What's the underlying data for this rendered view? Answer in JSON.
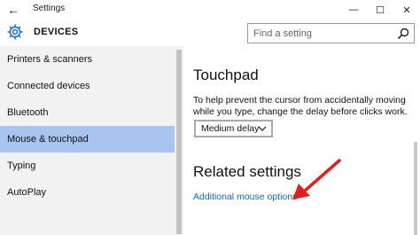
{
  "window": {
    "title": "Settings",
    "back_glyph": "←",
    "minimize_glyph": "—",
    "maximize_glyph": "☐",
    "close_glyph": "✕"
  },
  "header": {
    "title": "DEVICES",
    "icon": "gear-icon",
    "accent": "#1e73c8"
  },
  "search": {
    "placeholder": "Find a setting",
    "icon": "search-icon"
  },
  "sidebar": {
    "items": [
      {
        "label": "Printers & scanners",
        "selected": false
      },
      {
        "label": "Connected devices",
        "selected": false
      },
      {
        "label": "Bluetooth",
        "selected": false
      },
      {
        "label": "Mouse & touchpad",
        "selected": true
      },
      {
        "label": "Typing",
        "selected": false
      },
      {
        "label": "AutoPlay",
        "selected": false
      }
    ],
    "selected_color": "#a8c5f0"
  },
  "touchpad": {
    "title": "Touchpad",
    "description": "To help prevent the cursor from accidentally moving while you type, change the delay before clicks work.",
    "delay_value": "Medium delay"
  },
  "related": {
    "title": "Related settings",
    "link": "Additional mouse options",
    "link_color": "#1464c8"
  },
  "annotation": {
    "arrow_color": "#e0201a"
  }
}
